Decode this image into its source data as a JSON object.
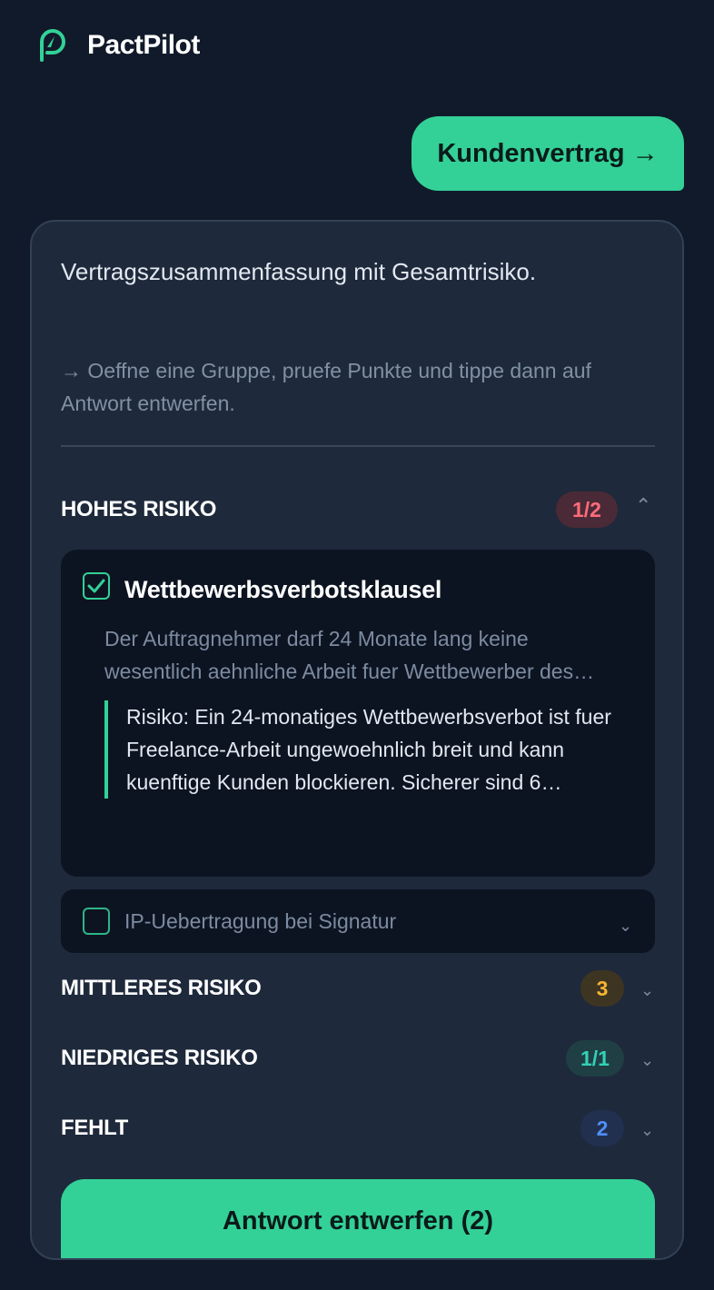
{
  "app": {
    "name": "PactPilot",
    "logo_icon": "compass-icon"
  },
  "chat": {
    "user_message": "Kundenvertrag →"
  },
  "panel": {
    "summary": "Vertragszusammenfassung mit Gesamtrisiko.",
    "hint": "→ Oeffne eine Gruppe, pruefe Punkte und tippe dann auf Antwort entwerfen.",
    "groups": [
      {
        "title": "HOHES RISIKO",
        "badge": "1/2",
        "expanded": true,
        "badge_color": "#ff6b7a"
      },
      {
        "title": "MITTLERES RISIKO",
        "badge": "3",
        "expanded": false,
        "badge_color": "#f5b433"
      },
      {
        "title": "NIEDRIGES RISIKO",
        "badge": "1/1",
        "expanded": false,
        "badge_color": "#33d1b5"
      },
      {
        "title": "FEHLT",
        "badge": "2",
        "expanded": false,
        "badge_color": "#4f8ff7"
      }
    ],
    "items": [
      {
        "title": "Wettbewerbsverbotsklausel",
        "checked": true,
        "description": "Der Auftragnehmer darf 24 Monate lang keine wesentlich aehnliche Arbeit fuer Wettbewerber des…",
        "risk": "Risiko: Ein 24-monatiges Wettbewerbsverbot ist fuer Freelance-Arbeit ungewoehnlich breit und kann kuenftige Kunden blockieren. Sicherer sind 6…"
      },
      {
        "title": "IP-Uebertragung bei Signatur",
        "checked": false
      }
    ],
    "cta_label": "Antwort entwerfen (2)"
  },
  "colors": {
    "accent": "#33d197",
    "background": "#111a2a",
    "panel": "#1e293b"
  }
}
